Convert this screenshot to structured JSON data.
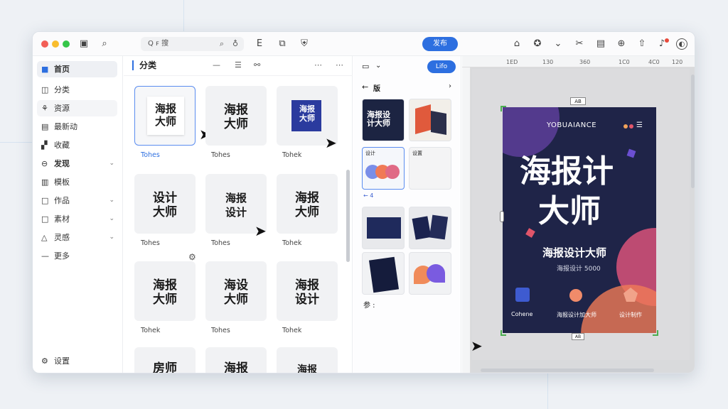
{
  "toolbar": {
    "search_text": "Q ꜰ 搜",
    "primary_button": "发布"
  },
  "sidebar": {
    "items": [
      {
        "label": "首页",
        "icon": "home-icon"
      },
      {
        "label": "分类",
        "icon": "category-icon"
      },
      {
        "label": "资源",
        "icon": "resource-icon"
      },
      {
        "label": "最新动",
        "icon": "news-icon"
      },
      {
        "label": "收藏",
        "icon": "favorite-icon"
      },
      {
        "label": "发现",
        "icon": "globe-icon"
      },
      {
        "label": "模板",
        "icon": "template-icon"
      },
      {
        "label": "作品",
        "icon": "works-icon"
      },
      {
        "label": "素材",
        "icon": "material-icon"
      },
      {
        "label": "灵感",
        "icon": "inspiration-icon"
      },
      {
        "label": "更多",
        "icon": "more-icon"
      }
    ],
    "footer_label": "设置"
  },
  "panel": {
    "title": "分类",
    "cards": [
      {
        "title": "海报\n大师",
        "label": "Tohes"
      },
      {
        "title": "海报\n大师",
        "label": "Tohes"
      },
      {
        "title": "海报\n大师",
        "label": "Tohek"
      },
      {
        "title": "设计\n大师",
        "label": "Tohes"
      },
      {
        "title": "海报\n设计",
        "label": "Tohes"
      },
      {
        "title": "海报\n大师",
        "label": "Tohek"
      },
      {
        "title": "海报\n大师",
        "label": "Tohek"
      },
      {
        "title": "海设\n大师",
        "label": "Tohes"
      },
      {
        "title": "海报\n设计",
        "label": "Tohek"
      },
      {
        "title": "房师",
        "label": ""
      },
      {
        "title": "海报",
        "label": ""
      },
      {
        "title": "海报",
        "label": ""
      }
    ]
  },
  "templates": {
    "button": "Lifo",
    "back_label": "版",
    "row_label_1": "设计",
    "row_label_2": "设置",
    "small_label": "← 4",
    "footer_label": "参 :"
  },
  "canvas": {
    "ruler_ticks": [
      "1ED",
      "130",
      "360",
      "1C0",
      "4C0",
      "120",
      "1S0"
    ],
    "top_badge": "AB",
    "bottom_badge": "AB",
    "poster": {
      "brand": "YOBUAIANCE",
      "headline_1": "海报计",
      "headline_2": "大师",
      "subtitle": "海报设计大师",
      "tagline": "海报设计 5000",
      "footer_1": "Cohene",
      "footer_2": "海报设计加大师",
      "footer_3": "设计制作"
    },
    "colors": {
      "poster_bg": "#1f2448",
      "accent_orange": "#f07a56",
      "accent_purple": "#6b4fd1",
      "accent_pink": "#e0556a"
    }
  }
}
